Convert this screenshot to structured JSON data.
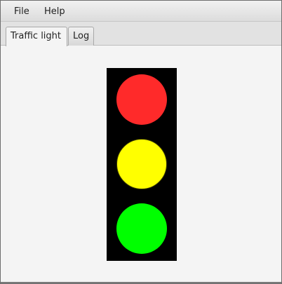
{
  "menubar": {
    "items": [
      {
        "label": "File"
      },
      {
        "label": "Help"
      }
    ]
  },
  "tabs": {
    "items": [
      {
        "label": "Traffic light",
        "selected": true
      },
      {
        "label": "Log",
        "selected": false
      }
    ]
  },
  "traffic_light": {
    "housing_color": "#000000",
    "lamps": [
      {
        "name": "red",
        "color": "#ff2a2a",
        "lit": true
      },
      {
        "name": "yellow",
        "color": "#ffff00",
        "lit": true
      },
      {
        "name": "green",
        "color": "#00ff00",
        "lit": true
      }
    ]
  }
}
